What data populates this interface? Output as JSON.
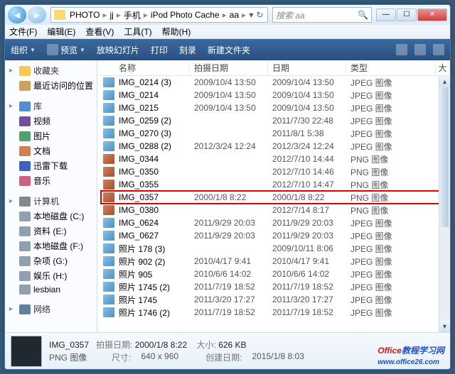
{
  "breadcrumb": [
    "PHOTO",
    "jj",
    "手机",
    "iPod Photo Cache",
    "aa"
  ],
  "search_placeholder": "搜索 aa",
  "menus": {
    "file": "文件(F)",
    "edit": "编辑(E)",
    "view": "查看(V)",
    "tools": "工具(T)",
    "help": "帮助(H)"
  },
  "toolbar": {
    "organize": "组织",
    "preview": "预览",
    "slideshow": "放映幻灯片",
    "print": "打印",
    "burn": "刻录",
    "newfolder": "新建文件夹"
  },
  "sidebar": {
    "favorites": "收藏夹",
    "recent": "最近访问的位置",
    "library": "库",
    "video": "视频",
    "pictures": "图片",
    "documents": "文档",
    "thunder": "迅雷下载",
    "music": "音乐",
    "computer": "计算机",
    "drive_c": "本地磁盘 (C:)",
    "drive_e": "资料 (E:)",
    "drive_f": "本地磁盘 (F:)",
    "drive_g": "杂项 (G:)",
    "drive_h": "娱乐 (H:)",
    "lesbian": "lesbian",
    "network": "网络"
  },
  "columns": {
    "name": "名称",
    "shot": "拍摄日期",
    "date": "日期",
    "type": "类型",
    "size": "大"
  },
  "files": [
    {
      "n": "IMG_0214 (3)",
      "d1": "2009/10/4 13:50",
      "d2": "2009/10/4 13:50",
      "t": "JPEG 图像",
      "k": "jpg"
    },
    {
      "n": "IMG_0214",
      "d1": "2009/10/4 13:50",
      "d2": "2009/10/4 13:50",
      "t": "JPEG 图像",
      "k": "jpg"
    },
    {
      "n": "IMG_0215",
      "d1": "2009/10/4 13:50",
      "d2": "2009/10/4 13:50",
      "t": "JPEG 图像",
      "k": "jpg"
    },
    {
      "n": "IMG_0259 (2)",
      "d1": "",
      "d2": "2011/7/30 22:48",
      "t": "JPEG 图像",
      "k": "jpg"
    },
    {
      "n": "IMG_0270 (3)",
      "d1": "",
      "d2": "2011/8/1 5:38",
      "t": "JPEG 图像",
      "k": "jpg"
    },
    {
      "n": "IMG_0288 (2)",
      "d1": "2012/3/24 12:24",
      "d2": "2012/3/24 12:24",
      "t": "JPEG 图像",
      "k": "jpg"
    },
    {
      "n": "IMG_0344",
      "d1": "",
      "d2": "2012/7/10 14:44",
      "t": "PNG 图像",
      "k": "png"
    },
    {
      "n": "IMG_0350",
      "d1": "",
      "d2": "2012/7/10 14:46",
      "t": "PNG 图像",
      "k": "png"
    },
    {
      "n": "IMG_0355",
      "d1": "",
      "d2": "2012/7/10 14:47",
      "t": "PNG 图像",
      "k": "png"
    },
    {
      "n": "IMG_0357",
      "d1": "2000/1/8 8:22",
      "d2": "2000/1/8 8:22",
      "t": "PNG 图像",
      "k": "png"
    },
    {
      "n": "IMG_0380",
      "d1": "",
      "d2": "2012/7/14 8:17",
      "t": "PNG 图像",
      "k": "png"
    },
    {
      "n": "IMG_0624",
      "d1": "2011/9/29 20:03",
      "d2": "2011/9/29 20:03",
      "t": "JPEG 图像",
      "k": "jpg"
    },
    {
      "n": "IMG_0627",
      "d1": "2011/9/29 20:03",
      "d2": "2011/9/29 20:03",
      "t": "JPEG 图像",
      "k": "jpg"
    },
    {
      "n": "照片 178 (3)",
      "d1": "",
      "d2": "2009/10/11 8:06",
      "t": "JPEG 图像",
      "k": "jpg"
    },
    {
      "n": "照片 902 (2)",
      "d1": "2010/4/17 9:41",
      "d2": "2010/4/17 9:41",
      "t": "JPEG 图像",
      "k": "jpg"
    },
    {
      "n": "照片 905",
      "d1": "2010/6/6 14:02",
      "d2": "2010/6/6 14:02",
      "t": "JPEG 图像",
      "k": "jpg"
    },
    {
      "n": "照片 1745 (2)",
      "d1": "2011/7/19 18:52",
      "d2": "2011/7/19 18:52",
      "t": "JPEG 图像",
      "k": "jpg"
    },
    {
      "n": "照片 1745",
      "d1": "2011/3/20 17:27",
      "d2": "2011/3/20 17:27",
      "t": "JPEG 图像",
      "k": "jpg"
    },
    {
      "n": "照片 1746 (2)",
      "d1": "2011/7/19 18:52",
      "d2": "2011/7/19 18:52",
      "t": "JPEG 图像",
      "k": "jpg"
    }
  ],
  "status": {
    "name": "IMG_0357",
    "shot_label": "拍摄日期:",
    "shot": "2000/1/8 8:22",
    "type_label": "",
    "type": "PNG 图像",
    "dim_label": "尺寸:",
    "dim": "640 x 960",
    "size_label": "大小:",
    "size": "626 KB",
    "created_label": "创建日期:",
    "created": "2015/1/8 8:03"
  },
  "watermark": {
    "a": "Office",
    "b": "教程学习网",
    "c": "www.office26.com"
  }
}
